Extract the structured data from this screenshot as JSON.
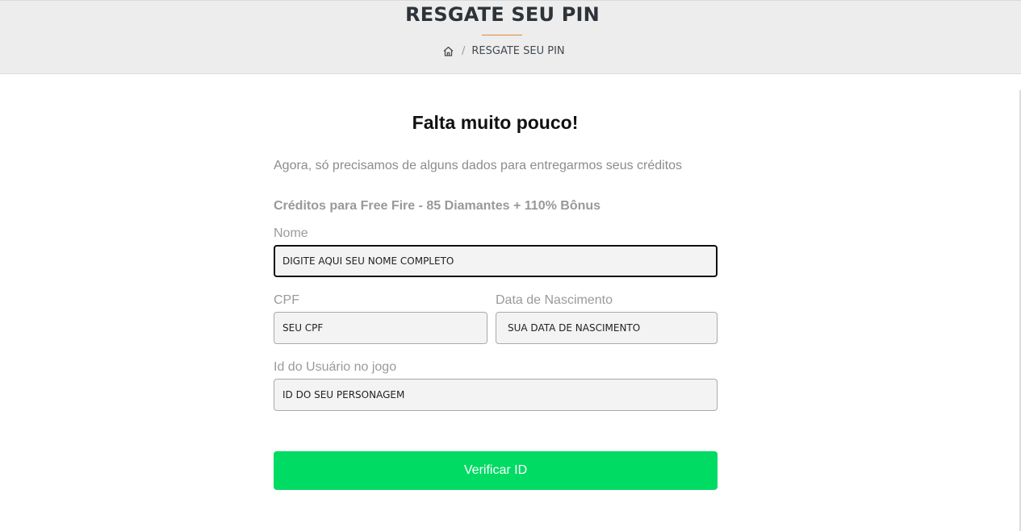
{
  "header": {
    "title": "RESGATE SEU PIN",
    "breadcrumb": {
      "home_icon": "home-icon",
      "separator": "/",
      "current": "RESGATE SEU PIN"
    },
    "accent_color": "#e08a3c"
  },
  "main": {
    "heading": "Falta muito pouco!",
    "subtitle": "Agora, só precisamos de alguns dados para entregarmos seus créditos",
    "credits": "Créditos para Free Fire - 85 Diamantes + 110% Bônus"
  },
  "form": {
    "name": {
      "label": "Nome",
      "placeholder": "DIGITE AQUI SEU NOME COMPLETO",
      "value": ""
    },
    "cpf": {
      "label": "CPF",
      "placeholder": "SEU CPF",
      "value": ""
    },
    "birthdate": {
      "label": "Data de Nascimento",
      "placeholder": "SUA DATA DE NASCIMENTO",
      "value": ""
    },
    "user_id": {
      "label": "Id do Usuário no jogo",
      "placeholder": "ID DO SEU PERSONAGEM",
      "value": ""
    },
    "submit_label": "Verificar ID",
    "submit_color": "#00db63"
  }
}
